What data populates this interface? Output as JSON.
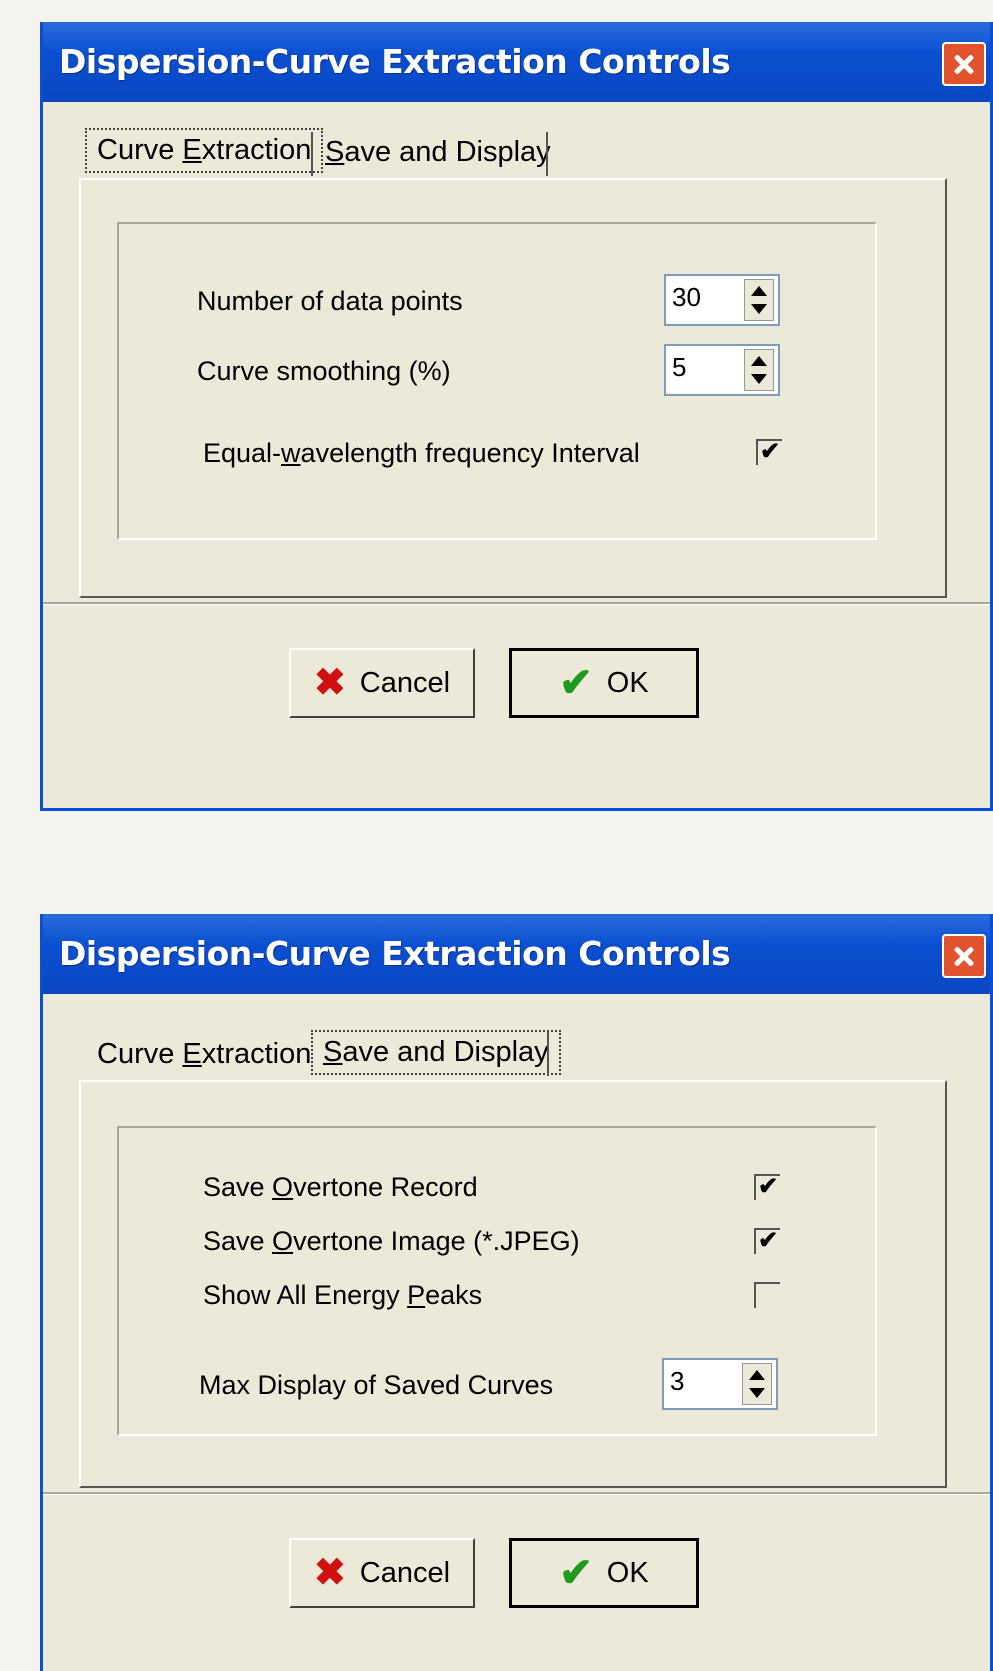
{
  "dialog1": {
    "title": "Dispersion-Curve Extraction Controls",
    "tabs": [
      {
        "pre": "Curve ",
        "key": "E",
        "post": "xtraction",
        "active": true
      },
      {
        "pre": "",
        "key": "S",
        "post": "ave and Display",
        "active": false
      }
    ],
    "fields": {
      "data_points_label": "Number of data points",
      "data_points_value": "30",
      "smoothing_label": "Curve smoothing (%)",
      "smoothing_value": "5",
      "equal_wl_pre": "Equal-",
      "equal_wl_key": "w",
      "equal_wl_post": "avelength frequency Interval",
      "equal_wl_checked": "✔"
    },
    "buttons": {
      "cancel": "Cancel",
      "ok": "OK"
    }
  },
  "dialog2": {
    "title": "Dispersion-Curve Extraction Controls",
    "tabs": [
      {
        "pre": "Curve ",
        "key": "E",
        "post": "xtraction",
        "active": false
      },
      {
        "pre": "",
        "key": "S",
        "post": "ave and Display",
        "active": true
      }
    ],
    "fields": {
      "overtone_record_pre": "Save ",
      "overtone_record_key": "O",
      "overtone_record_post": "vertone Record",
      "overtone_record_checked": "✔",
      "overtone_image_pre": "Save ",
      "overtone_image_key": "O",
      "overtone_image_post": "vertone Image (*.JPEG)",
      "overtone_image_checked": "✔",
      "energy_peaks_pre": "Show All Energy ",
      "energy_peaks_key": "P",
      "energy_peaks_post": "eaks",
      "energy_peaks_checked": "",
      "max_display_label": "Max Display of Saved Curves",
      "max_display_value": "3"
    },
    "buttons": {
      "cancel": "Cancel",
      "ok": "OK"
    }
  }
}
